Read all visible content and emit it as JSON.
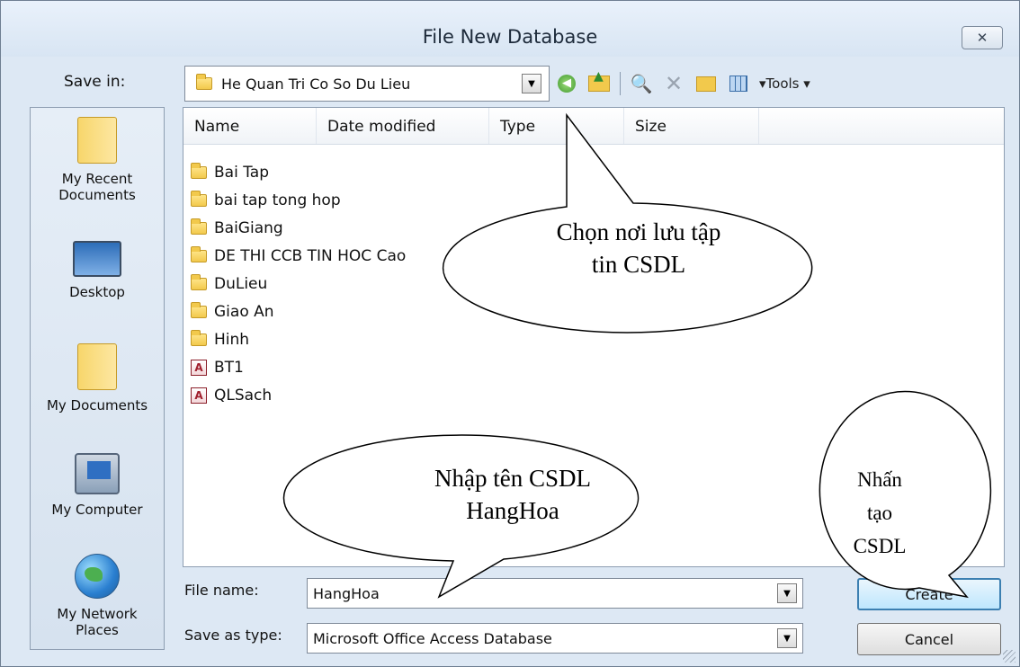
{
  "window": {
    "title": "File New Database",
    "close_label": "✕"
  },
  "save_in": {
    "label": "Save in:",
    "value": "He Quan Tri Co So Du Lieu"
  },
  "toolbar": {
    "tools_label": "▾Tools ▾"
  },
  "places": [
    {
      "label": "My Recent Documents",
      "icon": "recent-documents-folder-icon"
    },
    {
      "label": "Desktop",
      "icon": "desktop-icon"
    },
    {
      "label": "My Documents",
      "icon": "documents-folder-icon"
    },
    {
      "label": "My Computer",
      "icon": "computer-icon"
    },
    {
      "label": "My Network Places",
      "icon": "network-globe-icon"
    }
  ],
  "columns": [
    "Name",
    "Date modified",
    "Type",
    "Size"
  ],
  "items": [
    {
      "name": "Bai Tap",
      "kind": "folder"
    },
    {
      "name": "bai tap tong hop",
      "kind": "folder"
    },
    {
      "name": "BaiGiang",
      "kind": "folder"
    },
    {
      "name": "DE THI CCB TIN HOC Cao",
      "kind": "folder"
    },
    {
      "name": "DuLieu",
      "kind": "folder"
    },
    {
      "name": "Giao An",
      "kind": "folder"
    },
    {
      "name": "Hinh",
      "kind": "folder"
    },
    {
      "name": "BT1",
      "kind": "access-database"
    },
    {
      "name": "QLSach",
      "kind": "access-database"
    }
  ],
  "file_name": {
    "label": "File name:",
    "value": "HangHoa"
  },
  "save_as_type": {
    "label": "Save as type:",
    "value": "Microsoft Office Access Database"
  },
  "buttons": {
    "create": "Create",
    "cancel": "Cancel"
  },
  "callouts": {
    "location_line1": "Chọn nơi lưu tập",
    "location_line2": "tin CSDL",
    "name_line1": "Nhập tên CSDL",
    "name_line2": "HangHoa",
    "create_line1": "Nhấn",
    "create_line2": "tạo",
    "create_line3": "CSDL"
  }
}
